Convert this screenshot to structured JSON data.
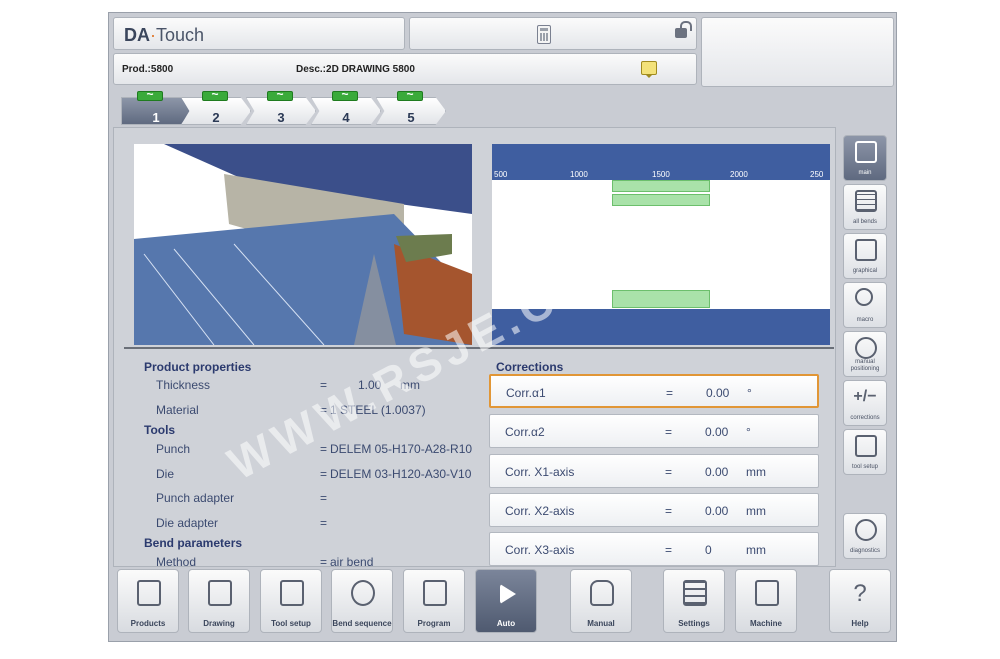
{
  "header": {
    "brand_da": "DA",
    "brand_touch": "Touch",
    "prod_label": "Prod.:5800",
    "desc_label": "Desc.:2D DRAWING 5800"
  },
  "bend_tabs": [
    {
      "label": "1",
      "active": true
    },
    {
      "label": "2",
      "active": false
    },
    {
      "label": "3",
      "active": false
    },
    {
      "label": "4",
      "active": false
    },
    {
      "label": "5",
      "active": false
    }
  ],
  "view2d": {
    "ruler_labels": [
      "500",
      "1000",
      "1500",
      "2000",
      "250"
    ]
  },
  "product_properties": {
    "title": "Product properties",
    "thickness_label": "Thickness",
    "thickness_value": "1.00",
    "thickness_unit": "mm",
    "material_label": "Material",
    "material_value": "1 STEEL (1.0037)"
  },
  "tools": {
    "title": "Tools",
    "punch_label": "Punch",
    "punch_value": "DELEM 05-H170-A28-R10",
    "die_label": "Die",
    "die_value": "DELEM 03-H120-A30-V10",
    "punch_adapter_label": "Punch adapter",
    "punch_adapter_value": "",
    "die_adapter_label": "Die adapter",
    "die_adapter_value": ""
  },
  "bend_parameters": {
    "title": "Bend parameters",
    "method_label": "Method",
    "method_value": "air bend"
  },
  "corrections": {
    "title": "Corrections",
    "rows": [
      {
        "label": "Corr.α1",
        "value": "0.00",
        "unit": "°",
        "selected": true
      },
      {
        "label": "Corr.α2",
        "value": "0.00",
        "unit": "°",
        "selected": false
      },
      {
        "label": "Corr. X1-axis",
        "value": "0.00",
        "unit": "mm",
        "selected": false
      },
      {
        "label": "Corr. X2-axis",
        "value": "0.00",
        "unit": "mm",
        "selected": false
      },
      {
        "label": "Corr. X3-axis",
        "value": "0",
        "unit": "mm",
        "selected": false
      }
    ]
  },
  "eq_sign": "=",
  "sidebar": [
    {
      "label": "main",
      "icon": "main-icon",
      "active": true
    },
    {
      "label": "all bends",
      "icon": "table-icon",
      "active": false
    },
    {
      "label": "graphical",
      "icon": "graph-icon",
      "active": false
    },
    {
      "label": "macro",
      "icon": "magnifier-icon",
      "active": false
    },
    {
      "label": "manual positioning",
      "icon": "dial-icon",
      "active": false
    },
    {
      "label": "corrections",
      "icon": "plus-minus-icon",
      "active": false
    },
    {
      "label": "tool setup",
      "icon": "tool-icon",
      "active": false
    },
    {
      "label": "diagnostics",
      "icon": "gauge-icon",
      "active": false
    }
  ],
  "bottom_bar": [
    {
      "label": "Products",
      "icon": "folder-icon",
      "active": false
    },
    {
      "label": "Drawing",
      "icon": "pencil-icon",
      "active": false
    },
    {
      "label": "Tool setup",
      "icon": "press-icon",
      "active": false
    },
    {
      "label": "Bend sequence",
      "icon": "sequence-icon",
      "active": false
    },
    {
      "label": "Program",
      "icon": "pages-icon",
      "active": false
    },
    {
      "label": "Auto",
      "icon": "play-icon",
      "active": true
    },
    {
      "label": "Manual",
      "icon": "hand-icon",
      "active": false
    },
    {
      "label": "Settings",
      "icon": "sliders-icon",
      "active": false
    },
    {
      "label": "Machine",
      "icon": "machine-icon",
      "active": false
    },
    {
      "label": "Help",
      "icon": "question-icon",
      "active": false
    }
  ],
  "watermark": "WWW.RSJE.COM",
  "colors": {
    "accent_orange": "#e19636",
    "ruler_blue": "#3f5ea0",
    "bend_green": "#a9e2a9",
    "badge_green": "#3aaa3a"
  }
}
